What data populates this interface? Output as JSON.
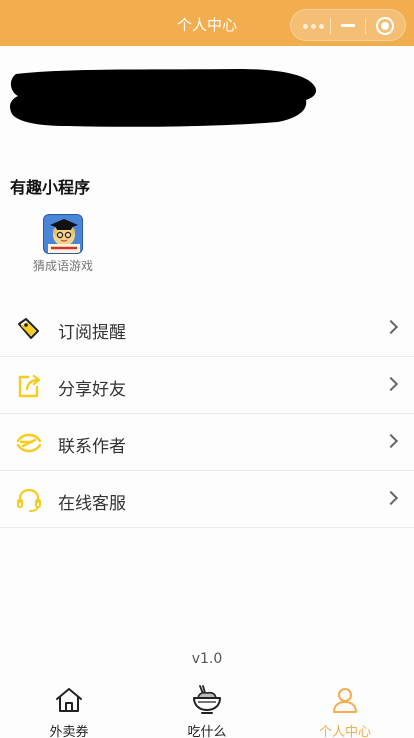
{
  "header": {
    "title": "个人中心",
    "menu_icon": "more-dots-icon",
    "minimize_icon": "minimize-icon",
    "close_icon": "target-close-icon"
  },
  "profile": {
    "redacted": true
  },
  "mini_programs": {
    "title": "有趣小程序",
    "items": [
      {
        "label": "猜成语游戏",
        "icon": "idiom-game-app-icon"
      }
    ]
  },
  "menu": {
    "items": [
      {
        "label": "订阅提醒",
        "icon": "tag-icon"
      },
      {
        "label": "分享好友",
        "icon": "share-icon"
      },
      {
        "label": "联系作者",
        "icon": "contact-icon"
      },
      {
        "label": "在线客服",
        "icon": "headset-icon"
      }
    ]
  },
  "version": "v1.0",
  "tabbar": {
    "items": [
      {
        "label": "外卖券",
        "icon": "home-icon",
        "active": false
      },
      {
        "label": "吃什么",
        "icon": "food-bowl-icon",
        "active": false
      },
      {
        "label": "个人中心",
        "icon": "user-icon",
        "active": true
      }
    ]
  },
  "colors": {
    "accent": "#f1ad4e",
    "icon_yellow": "#f5cc1f"
  }
}
